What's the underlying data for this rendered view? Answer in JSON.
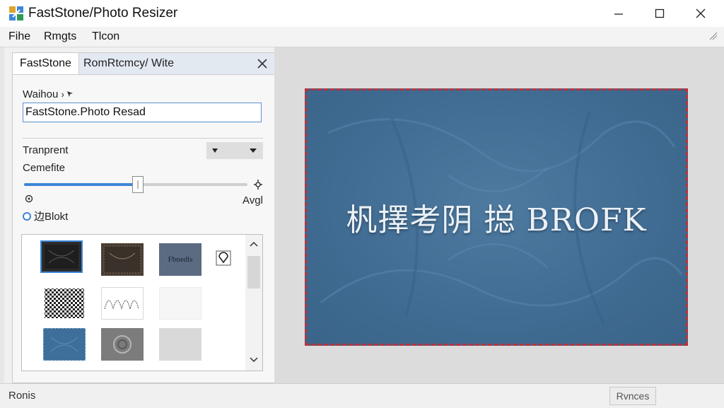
{
  "window": {
    "title": "FastStone/Photo Resizer"
  },
  "menu": {
    "items": [
      "Fihe",
      "Rmgts",
      "Tlcon"
    ]
  },
  "panel": {
    "tabs": [
      "FastStone",
      "RomRtcmcy/ Wite"
    ],
    "name_label": "Waihou",
    "name_value": "FastStone.Photo Resad",
    "transparent_label": "Tranprent",
    "cemefite_label": "Cemefite",
    "slider_value_pct": 51,
    "slider_right_label": "Avgl",
    "radio_label": "边Blokt",
    "gallery_text_thumb": "Fbnedls"
  },
  "preview": {
    "image_text": "杋擇考阴 搃 BROFK"
  },
  "status": {
    "left_text": "Ronis",
    "right_text": "Rvnces"
  },
  "colors": {
    "accent": "#3d85d8",
    "photo_border": "#b8323c",
    "photo_bg": "#416c93"
  }
}
